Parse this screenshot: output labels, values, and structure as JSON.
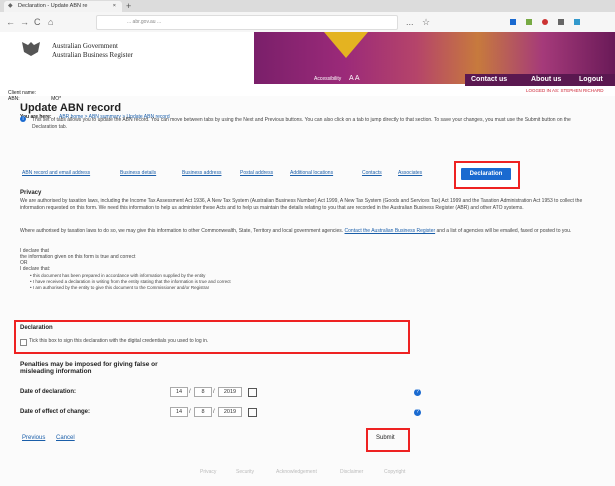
{
  "browser": {
    "tab_title": "Declaration - Update ABN re",
    "tab_close": "×",
    "new_tab": "+",
    "back": "←",
    "forward": "→",
    "reload": "C",
    "home": "⌂",
    "url": "... abr.gov.au ...",
    "menu": "...",
    "star": "☆"
  },
  "header": {
    "gov_line1": "Australian Government",
    "gov_line2": "Australian Business Register",
    "accessibility": "Accessibility",
    "text_size": "A A",
    "nav": [
      "Contact us",
      "About us",
      "Logout"
    ],
    "logged_in_as": "LOGGED IN AS: STEPHEN RICHARD",
    "client_name_label": "Client name:",
    "abn_label": "ABN:",
    "abn_value": "MO*",
    "you_are_here": "You are here:",
    "crumbs": [
      "ABR home",
      "ABN summary"
    ],
    "crumb_current": "Update ABN record"
  },
  "page": {
    "title": "Update ABN record",
    "intro": "This set of tabs allows you to update the ABN record. You can move between tabs by using the Next and Previous buttons. You can also click on a tab to jump directly to that section. To save your changes, you must use the Submit button on the Declaration tab.",
    "tabs": [
      "ABN record and email address",
      "Business details",
      "Business address",
      "Postal address",
      "Additional locations",
      "Contacts",
      "Associates"
    ],
    "declaration_tab": "Declaration",
    "privacy_heading": "Privacy",
    "privacy_para": "We are authorised by taxation laws, including the Income Tax Assessment Act 1936, A New Tax System (Australian Business Number) Act 1999, A New Tax System (Goods and Services Tax) Act 1999 and the Taxation Administration Act 1953 to collect the information requested on this form. We need this information to help us administer these Acts and to help us maintain the details relating to you that are recorded in the Australian Business Register (ABR) and other ATO systems.",
    "disclosure_para": "Where authorised by taxation laws to do so, we may give this information to other Commonwealth, State, Territory and local government agencies.",
    "disclosure_link": "Contact the Australian Business Register",
    "disclosure_tail": "and a list of agencies will be emailed, faxed or posted to you.",
    "declare_that": "I declare that",
    "declare_line": "the information given on this form is true and correct",
    "or": "OR",
    "declare_that_2": "I declare that:",
    "bullets": [
      "this document has been prepared in accordance with information supplied by the entity",
      "I have received a declaration in writing from the entity stating that the information is true and correct",
      "I am authorised by the entity to give this document to the Commissioner and/or Registrar"
    ],
    "declaration_heading": "Declaration",
    "declaration_checkbox": "Tick this box to sign this declaration with the digital credentials you used to log in.",
    "penalties": "Penalties may be imposed for giving false or misleading information",
    "date_of_declaration_label": "Date of declaration:",
    "date_of_effect_label": "Date of effect of change:",
    "date_of_declaration": {
      "d": "14",
      "m": "8",
      "y": "2019"
    },
    "date_of_effect": {
      "d": "14",
      "m": "8",
      "y": "2019"
    },
    "date_sep": "/",
    "help_mark": "?",
    "previous": "Previous",
    "cancel": "Cancel",
    "submit": "Submit"
  },
  "footer": [
    "Privacy",
    "Security",
    "Acknowledgement",
    "Disclaimer",
    "Copyright"
  ]
}
